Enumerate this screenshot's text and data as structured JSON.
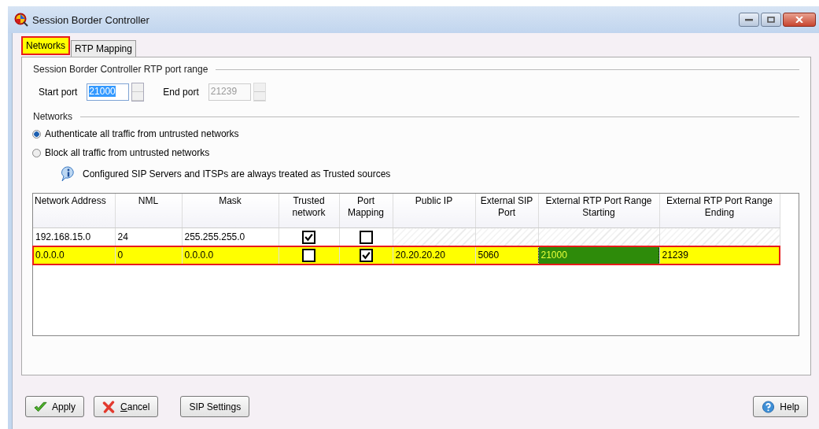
{
  "window": {
    "title": "Session Border Controller"
  },
  "tabs": [
    {
      "label": "Networks",
      "selected": true
    },
    {
      "label": "RTP Mapping",
      "selected": false
    }
  ],
  "port_range": {
    "heading": "Session Border Controller RTP port range",
    "start_label": "Start port",
    "start_value": "21000",
    "end_label": "End port",
    "end_value": "21239",
    "end_disabled": true
  },
  "networks": {
    "heading": "Networks",
    "options": [
      {
        "label": "Authenticate all traffic from untrusted networks",
        "selected": true
      },
      {
        "label": "Block all traffic from untrusted networks",
        "selected": false
      }
    ],
    "info": "Configured SIP Servers and ITSPs are always treated as Trusted sources"
  },
  "table": {
    "columns": [
      "Network Address",
      "NML",
      "Mask",
      "Trusted network",
      "Port Mapping",
      "Public IP",
      "External SIP Port",
      "External RTP Port Range Starting",
      "External RTP Port Range Ending"
    ],
    "rows": [
      {
        "selected": false,
        "cells": [
          {
            "kind": "text",
            "text": "192.168.15.0"
          },
          {
            "kind": "text",
            "text": "24"
          },
          {
            "kind": "text",
            "text": "255.255.255.0"
          },
          {
            "kind": "check",
            "checked": true
          },
          {
            "kind": "check",
            "checked": false
          },
          {
            "kind": "disabled"
          },
          {
            "kind": "disabled"
          },
          {
            "kind": "disabled"
          },
          {
            "kind": "disabled"
          }
        ]
      },
      {
        "selected": true,
        "cells": [
          {
            "kind": "text",
            "text": "0.0.0.0"
          },
          {
            "kind": "text",
            "text": "0"
          },
          {
            "kind": "text",
            "text": "0.0.0.0"
          },
          {
            "kind": "check",
            "checked": false
          },
          {
            "kind": "check",
            "checked": true
          },
          {
            "kind": "text",
            "text": "20.20.20.20"
          },
          {
            "kind": "text",
            "text": "5060"
          },
          {
            "kind": "text",
            "text": "21000",
            "focused": true
          },
          {
            "kind": "text",
            "text": "21239"
          }
        ]
      }
    ]
  },
  "buttons": [
    {
      "label": "Apply",
      "kind": "apply"
    },
    {
      "label": "Cancel",
      "kind": "cancel"
    },
    {
      "label": "SIP Settings",
      "kind": "plain"
    },
    {
      "label": "Help",
      "kind": "help"
    }
  ]
}
